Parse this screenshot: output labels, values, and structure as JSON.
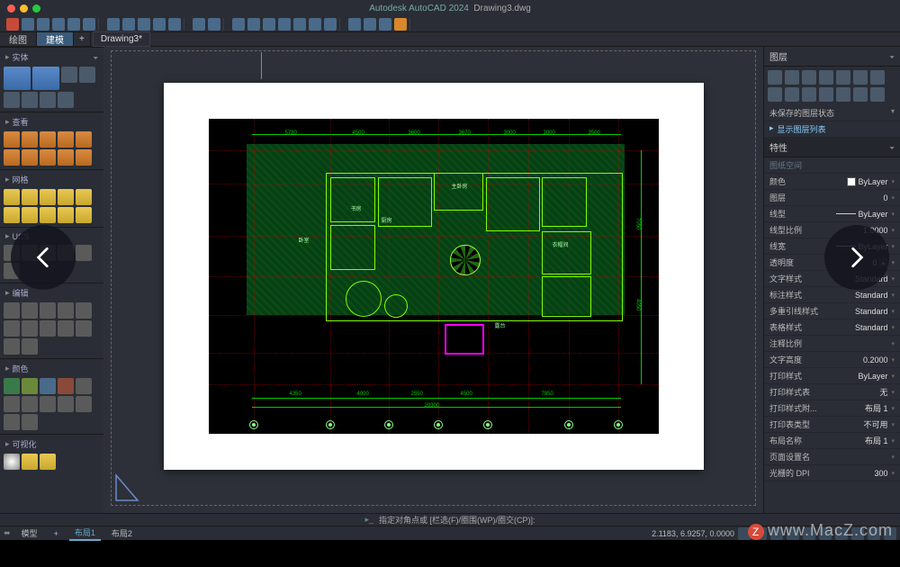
{
  "app": {
    "name": "Autodesk AutoCAD 2024",
    "document": "Drawing3.dwg"
  },
  "ribbon": {
    "tabs": [
      "绘图",
      "建模"
    ],
    "active": 1,
    "plus": "+",
    "filetab": "Drawing3*"
  },
  "left_sections": [
    "实体",
    "查看",
    "网格",
    "UCS",
    "编辑",
    "颜色",
    "可视化"
  ],
  "right": {
    "title": "图层",
    "state_row": "未保存的图层状态",
    "list_row": "显示图层列表",
    "props_title": "特性",
    "subhead": "图纸空间",
    "rows": [
      {
        "label": "颜色",
        "value": "ByLayer",
        "swatch": true
      },
      {
        "label": "图层",
        "value": "0"
      },
      {
        "label": "线型",
        "value": "ByLayer",
        "line": true
      },
      {
        "label": "线型比例",
        "value": "1.0000"
      },
      {
        "label": "线宽",
        "value": "ByLayer",
        "line": true
      },
      {
        "label": "透明度",
        "value": "0",
        "spin": true
      },
      {
        "label": "文字样式",
        "value": "Standard"
      },
      {
        "label": "标注样式",
        "value": "Standard"
      },
      {
        "label": "多重引线样式",
        "value": "Standard"
      },
      {
        "label": "表格样式",
        "value": "Standard"
      },
      {
        "label": "注释比例",
        "value": ""
      },
      {
        "label": "文字高度",
        "value": "0.2000"
      },
      {
        "label": "打印样式",
        "value": "ByLayer"
      },
      {
        "label": "打印样式表",
        "value": "无"
      },
      {
        "label": "打印样式附...",
        "value": "布局 1"
      },
      {
        "label": "打印表类型",
        "value": "不可用"
      },
      {
        "label": "布局名称",
        "value": "布局 1"
      },
      {
        "label": "页面设置名",
        "value": ""
      },
      {
        "label": "光栅的 DPI",
        "value": "300"
      }
    ]
  },
  "dimensions": {
    "top": [
      "5780",
      "4500",
      "3600",
      "3670",
      "3000",
      "3000",
      "3500"
    ],
    "bottom": [
      "4350",
      "4000",
      "2550",
      "4500",
      "7850"
    ],
    "overall": "29300",
    "right": [
      "7050",
      "4050"
    ]
  },
  "rooms": [
    "卧室",
    "书房",
    "主卧房",
    "厨房",
    "衣帽间",
    "露台"
  ],
  "command": "指定对角点或 [栏选(F)/圈围(WP)/圈交(CP)]:",
  "layout_tabs": {
    "model": "模型",
    "plus": "+",
    "l1": "布局1",
    "l2": "布局2"
  },
  "status": {
    "coords": "2.1183, 6.9257, 0.0000"
  },
  "watermark": "www.MacZ.com"
}
